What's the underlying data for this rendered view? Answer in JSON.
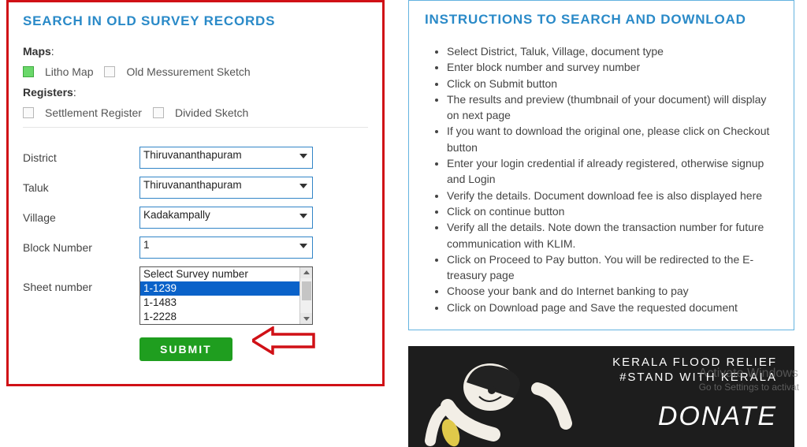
{
  "search_panel": {
    "title": "SEARCH IN OLD SURVEY RECORDS",
    "maps_label": "Maps",
    "registers_label": "Registers",
    "maps": {
      "litho": {
        "label": "Litho Map",
        "checked": true
      },
      "old_sketch": {
        "label": "Old Messurement Sketch",
        "checked": false
      }
    },
    "registers": {
      "settlement": {
        "label": "Settlement Register",
        "checked": false
      },
      "divided": {
        "label": "Divided Sketch",
        "checked": false
      }
    },
    "fields": {
      "district": {
        "label": "District",
        "value": "Thiruvananthapuram"
      },
      "taluk": {
        "label": "Taluk",
        "value": "Thiruvananthapuram"
      },
      "village": {
        "label": "Village",
        "value": "Kadakampally"
      },
      "block": {
        "label": "Block Number",
        "value": "1"
      },
      "sheet": {
        "label": "Sheet number",
        "options": [
          "Select Survey number",
          "1-1239",
          "1-1483",
          "1-2228"
        ],
        "selected_index": 1
      }
    },
    "submit_label": "SUBMIT"
  },
  "instructions_panel": {
    "title": "INSTRUCTIONS TO SEARCH AND DOWNLOAD",
    "items": [
      "Select District, Taluk, Village, document type",
      "Enter block number and survey number",
      "Click on Submit button",
      "The results and preview (thumbnail of your document) will display on next page",
      "If you want to download the original one, please click on Checkout button",
      "Enter your login credential if already registered, otherwise signup and Login",
      "Verify the details. Document download fee is also displayed here",
      "Click on continue button",
      "Verify all the details. Note down the transaction number for future communication with KLIM.",
      "Click on Proceed to Pay button. You will be redirected to the E-treasury page",
      "Choose your bank and do Internet banking to pay",
      "Click on Download page and Save the requested document"
    ]
  },
  "banner": {
    "line1": "KERALA FLOOD RELIEF",
    "line2": "#STAND WITH KERALA",
    "donate": "DONATE"
  },
  "watermark": {
    "title": "Activate Windows",
    "sub": "Go to Settings to activat"
  }
}
